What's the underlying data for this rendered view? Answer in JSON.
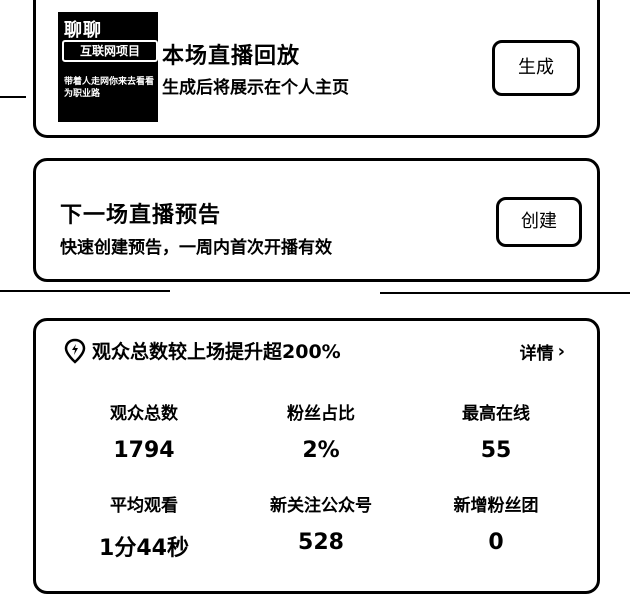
{
  "replay_card": {
    "thumbnail": {
      "line1": "聊聊",
      "line2": "互联网项目",
      "line3": "带着人走网你来去看看为职业路"
    },
    "title": "本场直播回放",
    "subtitle": "生成后将展示在个人主页",
    "button_label": "生成"
  },
  "preview_card": {
    "title": "下一场直播预告",
    "subtitle": "快速创建预告，一周内首次开播有效",
    "button_label": "创建"
  },
  "stats_card": {
    "insight_icon": "location-pin-icon",
    "insight_text": "观众总数较上场提升超200%",
    "details_label": "详情",
    "details_icon": "chevron-right-icon",
    "stats": [
      {
        "label": "观众总数",
        "value": "1794"
      },
      {
        "label": "粉丝占比",
        "value": "2%"
      },
      {
        "label": "最高在线",
        "value": "55"
      },
      {
        "label": "平均观看",
        "value": "1分44秒"
      },
      {
        "label": "新关注公众号",
        "value": "528"
      },
      {
        "label": "新增粉丝团",
        "value": "0"
      }
    ]
  }
}
